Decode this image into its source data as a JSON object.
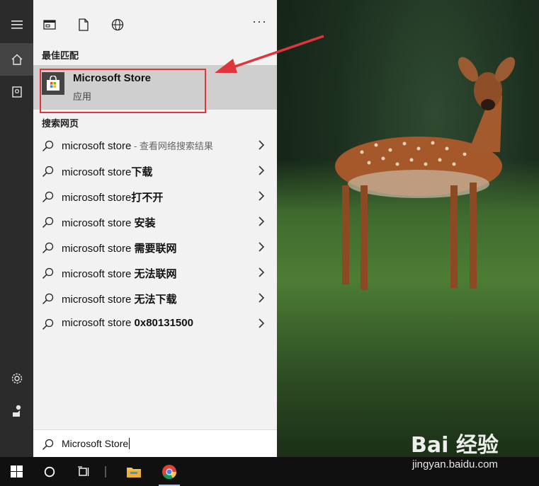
{
  "panel": {
    "toolbar": {
      "more_label": "···",
      "icons": [
        "app-window-icon",
        "document-icon",
        "globe-icon"
      ]
    },
    "best_match": {
      "section_label": "最佳匹配",
      "app_name": "Microsoft Store",
      "app_type": "应用"
    },
    "web": {
      "section_label": "搜索网页",
      "results": [
        {
          "prefix": "microsoft store",
          "bold": "",
          "hint": " - 查看网络搜索结果"
        },
        {
          "prefix": "microsoft store",
          "bold": "下载",
          "hint": ""
        },
        {
          "prefix": "microsoft store",
          "bold": "打不开",
          "hint": ""
        },
        {
          "prefix": "microsoft store ",
          "bold": "安装",
          "hint": ""
        },
        {
          "prefix": "microsoft store ",
          "bold": "需要联网",
          "hint": ""
        },
        {
          "prefix": "microsoft store ",
          "bold": "无法联网",
          "hint": ""
        },
        {
          "prefix": "microsoft store ",
          "bold": "无法下载",
          "hint": ""
        },
        {
          "prefix": "microsoft store ",
          "bold": "0x80131500",
          "hint": ""
        }
      ]
    },
    "search": {
      "query": "Microsoft Store"
    }
  },
  "rail": {
    "items": [
      "hamburger-icon",
      "home-icon",
      "notebook-icon",
      "settings-icon",
      "feedback-icon"
    ]
  },
  "taskbar": {
    "items": [
      "windows-start-icon",
      "cortana-icon",
      "task-view-icon",
      "file-explorer-icon",
      "chrome-icon"
    ]
  },
  "watermark": {
    "brand": "Bai 经验",
    "url": "jingyan.baidu.com"
  },
  "colors": {
    "highlight": "#e0353b",
    "panel_bg": "#f2f2f2",
    "rail_bg": "#2b2b2b",
    "taskbar_bg": "#101010"
  }
}
